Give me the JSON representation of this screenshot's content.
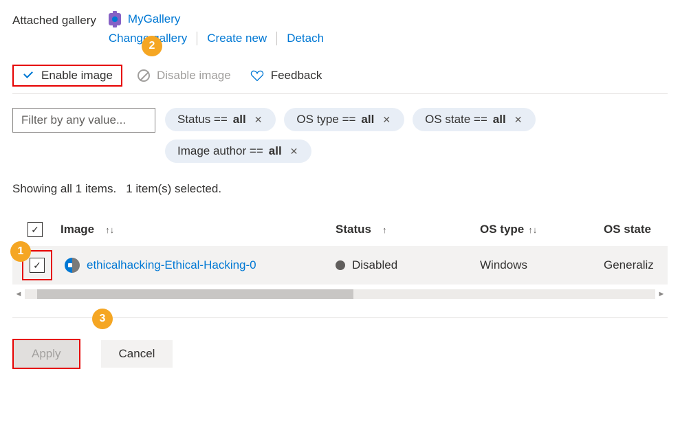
{
  "header": {
    "attached_label": "Attached gallery",
    "gallery_name": "MyGallery",
    "actions": {
      "change": "Change gallery",
      "create": "Create new",
      "detach": "Detach"
    }
  },
  "toolbar": {
    "enable": "Enable image",
    "disable": "Disable image",
    "feedback": "Feedback"
  },
  "filter": {
    "placeholder": "Filter by any value...",
    "pills": {
      "status_label": "Status == ",
      "status_value": "all",
      "ostype_label": "OS type == ",
      "ostype_value": "all",
      "osstate_label": "OS state == ",
      "osstate_value": "all",
      "author_label": "Image author == ",
      "author_value": "all"
    }
  },
  "showing": {
    "count_text": "Showing all 1 items.",
    "selected_text": "1 item(s) selected."
  },
  "table": {
    "columns": {
      "image": "Image",
      "status": "Status",
      "ostype": "OS type",
      "osstate": "OS state"
    },
    "row": {
      "image": "ethicalhacking-Ethical-Hacking-0",
      "status": "Disabled",
      "ostype": "Windows",
      "osstate": "Generaliz"
    }
  },
  "footer": {
    "apply": "Apply",
    "cancel": "Cancel"
  },
  "annotations": {
    "b1": "1",
    "b2": "2",
    "b3": "3"
  }
}
